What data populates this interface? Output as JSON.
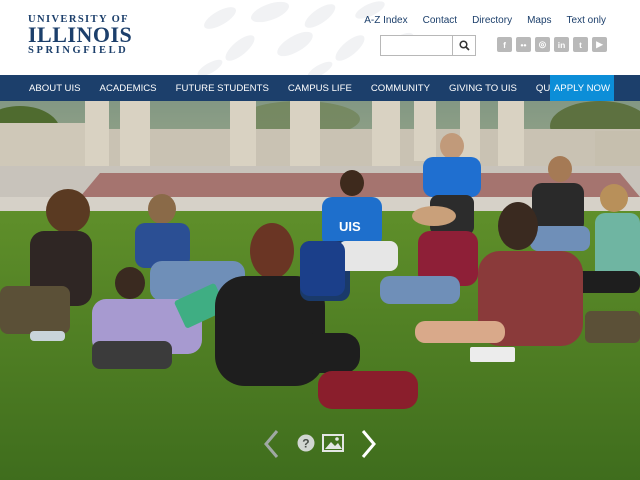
{
  "logo": {
    "line1": "UNIVERSITY OF",
    "line2": "ILLINOIS",
    "line3": "SPRINGFIELD"
  },
  "utility_links": [
    "A-Z Index",
    "Contact",
    "Directory",
    "Maps",
    "Text only"
  ],
  "search": {
    "placeholder": "",
    "value": "",
    "button_icon": "search-icon"
  },
  "social_icons": [
    {
      "name": "facebook-icon",
      "glyph": "f"
    },
    {
      "name": "flickr-icon",
      "glyph": "••"
    },
    {
      "name": "instagram-icon",
      "glyph": "◎"
    },
    {
      "name": "linkedin-icon",
      "glyph": "in"
    },
    {
      "name": "twitter-icon",
      "glyph": "t"
    },
    {
      "name": "youtube-icon",
      "glyph": "▶"
    }
  ],
  "nav": {
    "items": [
      "ABOUT UIS",
      "ACADEMICS",
      "FUTURE STUDENTS",
      "CAMPUS LIFE",
      "COMMUNITY",
      "GIVING TO UIS",
      "QUICK LINKS"
    ],
    "apply": "APPLY NOW"
  },
  "hero": {
    "student_shirt_text": "UIS"
  },
  "carousel": {
    "controls": [
      "prev-arrow-icon",
      "help-icon",
      "gallery-icon",
      "next-arrow-icon"
    ]
  },
  "colors": {
    "brand_navy": "#1c3f6b",
    "apply_blue": "#0c8ed8",
    "social_gray": "#b9b9b9"
  }
}
